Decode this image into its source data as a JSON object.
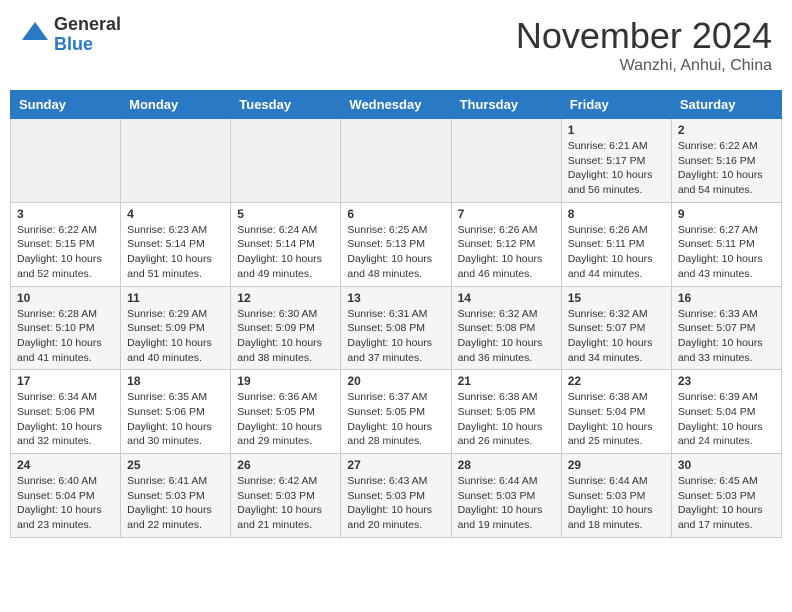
{
  "header": {
    "logo_general": "General",
    "logo_blue": "Blue",
    "month": "November 2024",
    "location": "Wanzhi, Anhui, China"
  },
  "weekdays": [
    "Sunday",
    "Monday",
    "Tuesday",
    "Wednesday",
    "Thursday",
    "Friday",
    "Saturday"
  ],
  "weeks": [
    [
      {
        "day": "",
        "content": ""
      },
      {
        "day": "",
        "content": ""
      },
      {
        "day": "",
        "content": ""
      },
      {
        "day": "",
        "content": ""
      },
      {
        "day": "",
        "content": ""
      },
      {
        "day": "1",
        "content": "Sunrise: 6:21 AM\nSunset: 5:17 PM\nDaylight: 10 hours and 56 minutes."
      },
      {
        "day": "2",
        "content": "Sunrise: 6:22 AM\nSunset: 5:16 PM\nDaylight: 10 hours and 54 minutes."
      }
    ],
    [
      {
        "day": "3",
        "content": "Sunrise: 6:22 AM\nSunset: 5:15 PM\nDaylight: 10 hours and 52 minutes."
      },
      {
        "day": "4",
        "content": "Sunrise: 6:23 AM\nSunset: 5:14 PM\nDaylight: 10 hours and 51 minutes."
      },
      {
        "day": "5",
        "content": "Sunrise: 6:24 AM\nSunset: 5:14 PM\nDaylight: 10 hours and 49 minutes."
      },
      {
        "day": "6",
        "content": "Sunrise: 6:25 AM\nSunset: 5:13 PM\nDaylight: 10 hours and 48 minutes."
      },
      {
        "day": "7",
        "content": "Sunrise: 6:26 AM\nSunset: 5:12 PM\nDaylight: 10 hours and 46 minutes."
      },
      {
        "day": "8",
        "content": "Sunrise: 6:26 AM\nSunset: 5:11 PM\nDaylight: 10 hours and 44 minutes."
      },
      {
        "day": "9",
        "content": "Sunrise: 6:27 AM\nSunset: 5:11 PM\nDaylight: 10 hours and 43 minutes."
      }
    ],
    [
      {
        "day": "10",
        "content": "Sunrise: 6:28 AM\nSunset: 5:10 PM\nDaylight: 10 hours and 41 minutes."
      },
      {
        "day": "11",
        "content": "Sunrise: 6:29 AM\nSunset: 5:09 PM\nDaylight: 10 hours and 40 minutes."
      },
      {
        "day": "12",
        "content": "Sunrise: 6:30 AM\nSunset: 5:09 PM\nDaylight: 10 hours and 38 minutes."
      },
      {
        "day": "13",
        "content": "Sunrise: 6:31 AM\nSunset: 5:08 PM\nDaylight: 10 hours and 37 minutes."
      },
      {
        "day": "14",
        "content": "Sunrise: 6:32 AM\nSunset: 5:08 PM\nDaylight: 10 hours and 36 minutes."
      },
      {
        "day": "15",
        "content": "Sunrise: 6:32 AM\nSunset: 5:07 PM\nDaylight: 10 hours and 34 minutes."
      },
      {
        "day": "16",
        "content": "Sunrise: 6:33 AM\nSunset: 5:07 PM\nDaylight: 10 hours and 33 minutes."
      }
    ],
    [
      {
        "day": "17",
        "content": "Sunrise: 6:34 AM\nSunset: 5:06 PM\nDaylight: 10 hours and 32 minutes."
      },
      {
        "day": "18",
        "content": "Sunrise: 6:35 AM\nSunset: 5:06 PM\nDaylight: 10 hours and 30 minutes."
      },
      {
        "day": "19",
        "content": "Sunrise: 6:36 AM\nSunset: 5:05 PM\nDaylight: 10 hours and 29 minutes."
      },
      {
        "day": "20",
        "content": "Sunrise: 6:37 AM\nSunset: 5:05 PM\nDaylight: 10 hours and 28 minutes."
      },
      {
        "day": "21",
        "content": "Sunrise: 6:38 AM\nSunset: 5:05 PM\nDaylight: 10 hours and 26 minutes."
      },
      {
        "day": "22",
        "content": "Sunrise: 6:38 AM\nSunset: 5:04 PM\nDaylight: 10 hours and 25 minutes."
      },
      {
        "day": "23",
        "content": "Sunrise: 6:39 AM\nSunset: 5:04 PM\nDaylight: 10 hours and 24 minutes."
      }
    ],
    [
      {
        "day": "24",
        "content": "Sunrise: 6:40 AM\nSunset: 5:04 PM\nDaylight: 10 hours and 23 minutes."
      },
      {
        "day": "25",
        "content": "Sunrise: 6:41 AM\nSunset: 5:03 PM\nDaylight: 10 hours and 22 minutes."
      },
      {
        "day": "26",
        "content": "Sunrise: 6:42 AM\nSunset: 5:03 PM\nDaylight: 10 hours and 21 minutes."
      },
      {
        "day": "27",
        "content": "Sunrise: 6:43 AM\nSunset: 5:03 PM\nDaylight: 10 hours and 20 minutes."
      },
      {
        "day": "28",
        "content": "Sunrise: 6:44 AM\nSunset: 5:03 PM\nDaylight: 10 hours and 19 minutes."
      },
      {
        "day": "29",
        "content": "Sunrise: 6:44 AM\nSunset: 5:03 PM\nDaylight: 10 hours and 18 minutes."
      },
      {
        "day": "30",
        "content": "Sunrise: 6:45 AM\nSunset: 5:03 PM\nDaylight: 10 hours and 17 minutes."
      }
    ]
  ]
}
